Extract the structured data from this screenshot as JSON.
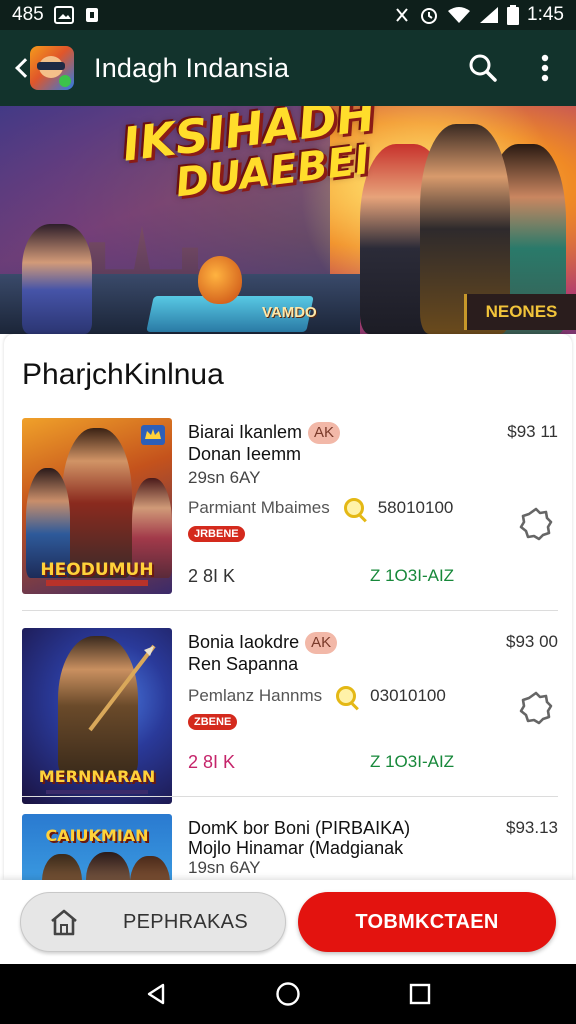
{
  "status_bar": {
    "time_left": "485",
    "time_right": "1:45"
  },
  "app_bar": {
    "title": "Indagh Indansia",
    "icons": [
      "back-icon",
      "app-logo",
      "search-icon",
      "more-vert-icon"
    ]
  },
  "banner": {
    "title_line1": "IKSIHADH",
    "title_line2": "DUAEBEI",
    "subtitle": "VAMDO",
    "tag": "NEONES"
  },
  "section": {
    "title": "PharjchKinlnua"
  },
  "items": [
    {
      "name_line1": "Biarai Ikanlem",
      "name_line2": "Donan Ieemm",
      "badge": "AK",
      "date": "29sn 6AY",
      "price": "$93 11",
      "meta_label": "Parmiant Mbaimes",
      "meta_value": "58010100",
      "pill": "JRBENE",
      "count": "2 8I K",
      "change": "Z 1O3I-AIZ",
      "thumb_caption": "HEODUMUH"
    },
    {
      "name_line1": "Bonia Iaokdre",
      "name_line2": "Ren Sapanna",
      "badge": "AK",
      "date": "",
      "price": "$93 00",
      "meta_label": "Pemlanz Hannms",
      "meta_value": "03010100",
      "pill": "ZBENE",
      "count": "2 8I K",
      "change": "Z 1O3I-AIZ",
      "thumb_caption": "MERNNARAN"
    },
    {
      "name_line1": "DomK  bor Boni  (PIRBAIKA)",
      "name_line2": "Mojlo Hinamar  (Madgianak",
      "badge": "",
      "date": "19sn 6AY",
      "price": "$93.13",
      "thumb_caption": "CAIUKMIAN"
    }
  ],
  "bottom_bar": {
    "secondary_label": "PEPHRAKAS",
    "primary_label": "TOBMKCTAEN"
  },
  "colors": {
    "status_bar": "#0e1f1b",
    "app_bar": "#12332c",
    "primary_button": "#e3130f",
    "change_text": "#17883a"
  }
}
